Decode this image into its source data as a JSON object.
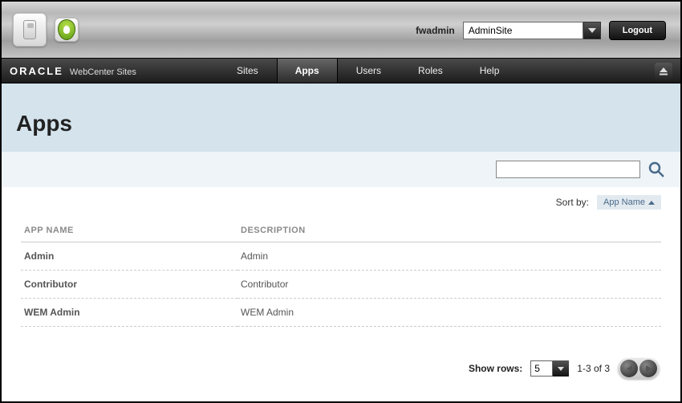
{
  "topbar": {
    "user_label": "fwadmin",
    "site_value": "AdminSite",
    "logout_label": "Logout"
  },
  "brand": {
    "oracle": "ORACLE",
    "product": "WebCenter Sites"
  },
  "nav": {
    "items": [
      {
        "label": "Sites",
        "active": false
      },
      {
        "label": "Apps",
        "active": true
      },
      {
        "label": "Users",
        "active": false
      },
      {
        "label": "Roles",
        "active": false
      },
      {
        "label": "Help",
        "active": false
      }
    ]
  },
  "page": {
    "title": "Apps"
  },
  "search": {
    "placeholder": ""
  },
  "sort": {
    "label": "Sort by:",
    "current": "App Name"
  },
  "table": {
    "columns": {
      "name": "APP NAME",
      "desc": "DESCRIPTION"
    },
    "rows": [
      {
        "name": "Admin",
        "desc": "Admin"
      },
      {
        "name": "Contributor",
        "desc": "Contributor"
      },
      {
        "name": "WEM Admin",
        "desc": "WEM Admin"
      }
    ]
  },
  "pager": {
    "show_rows_label": "Show rows:",
    "rows_value": "5",
    "range_text": "1-3 of 3"
  }
}
